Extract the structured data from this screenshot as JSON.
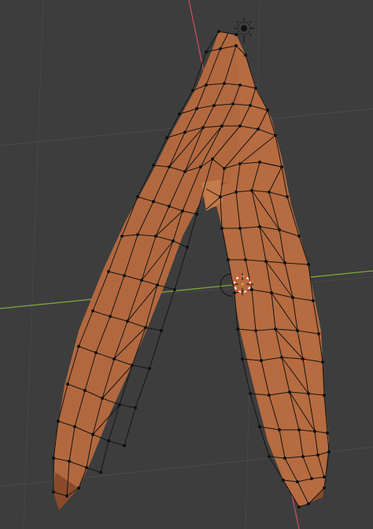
{
  "viewport": {
    "background_color": "#3d3d3d",
    "grid_color": "#4a4a4a",
    "x_axis_color": "#7fa63a",
    "y_axis_color": "#c9505c",
    "mesh_fill_color": "#b2683f",
    "mesh_shadow_color": "#8a4a2a",
    "wire_color": "#151515",
    "cursor_color": "#e34a2b"
  },
  "objects": {
    "mesh_name": "mesh-object",
    "light_icon": "light-icon",
    "cursor_icon": "3d-cursor-icon",
    "origin_icon": "object-origin-icon"
  }
}
